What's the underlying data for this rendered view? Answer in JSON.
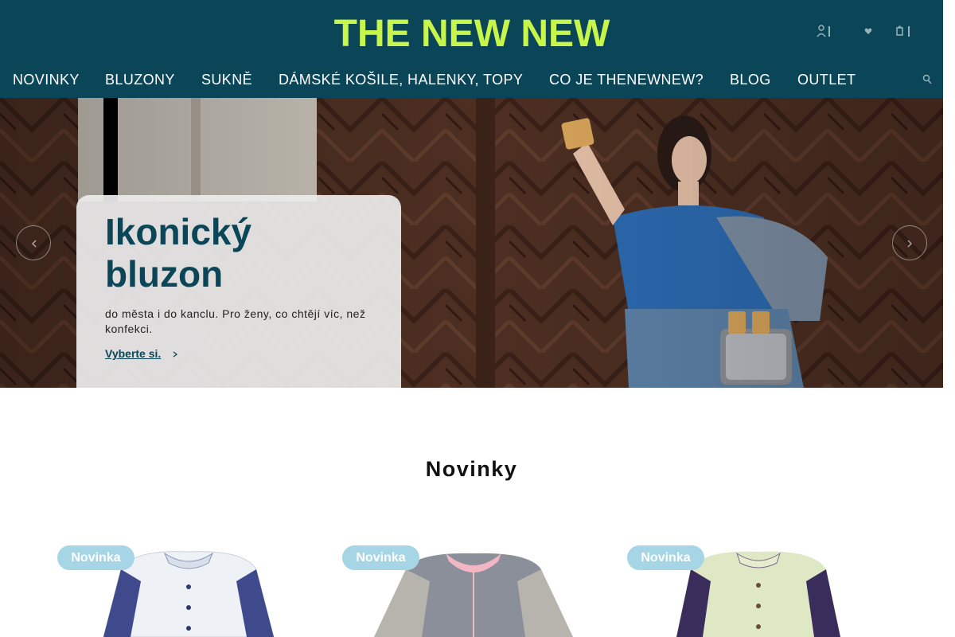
{
  "brand": {
    "name": "THE NEW NEW",
    "accent_color": "#c8f54a",
    "header_color": "#0a4658"
  },
  "header_icons": [
    "user-icon",
    "heart-icon",
    "cart-icon"
  ],
  "nav": {
    "items": [
      {
        "label": "NOVINKY"
      },
      {
        "label": "BLUZONY"
      },
      {
        "label": "SUKNĚ"
      },
      {
        "label": "DÁMSKÉ KOŠILE, HALENKY, TOPY"
      },
      {
        "label": "CO JE THENEWNEW?"
      },
      {
        "label": "BLOG"
      },
      {
        "label": "OUTLET"
      }
    ],
    "search_icon": "search-icon"
  },
  "hero": {
    "title": "Ikonický bluzon",
    "text": "do města i do kanclu. Pro ženy, co chtějí víc, než konfekci.",
    "link": "Vyberte si.",
    "prev_icon": "chevron-left-icon",
    "next_icon": "chevron-right-icon"
  },
  "section": {
    "title": "Novinky"
  },
  "products": [
    {
      "badge": "Novinka",
      "badge_color": "#a6d6e6"
    },
    {
      "badge": "Novinka",
      "badge_color": "#a6d6e6"
    },
    {
      "badge": "Novinka",
      "badge_color": "#a6d6e6"
    }
  ]
}
